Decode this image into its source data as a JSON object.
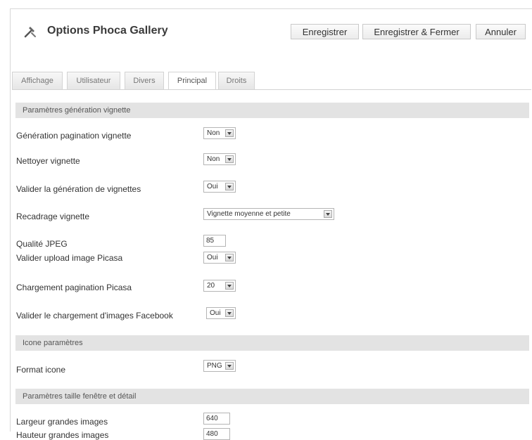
{
  "header": {
    "title": "Options Phoca Gallery",
    "save_label": "Enregistrer",
    "save_close_label": "Enregistrer & Fermer",
    "cancel_label": "Annuler"
  },
  "tabs": [
    {
      "label": "Affichage"
    },
    {
      "label": "Utilisateur"
    },
    {
      "label": "Divers"
    },
    {
      "label": "Principal",
      "active": true
    },
    {
      "label": "Droits"
    }
  ],
  "sections": {
    "thumbnail_generation": "Paramètres génération vignette",
    "icon_params": "Icone paramètres",
    "window_size": "Paramètres taille fenêtre et détail"
  },
  "fields": {
    "thumb_pagination": {
      "label": "Génération pagination vignette",
      "value": "Non"
    },
    "clean_thumbs": {
      "label": "Nettoyer vignette",
      "value": "Non"
    },
    "enable_thumb_gen": {
      "label": "Valider la génération de vignettes",
      "value": "Oui"
    },
    "thumb_crop": {
      "label": "Recadrage vignette",
      "value": "Vignette moyenne et petite"
    },
    "jpeg_quality": {
      "label": "Qualité JPEG",
      "value": "85"
    },
    "picasa_upload": {
      "label": "Valider upload image Picasa",
      "value": "Oui"
    },
    "picasa_pagination": {
      "label": "Chargement pagination Picasa",
      "value": "20"
    },
    "facebook_upload": {
      "label": "Valider le chargement d'images Facebook",
      "value": "Oui"
    },
    "icon_format": {
      "label": "Format icone",
      "value": "PNG"
    },
    "large_width": {
      "label": "Largeur grandes images",
      "value": "640"
    },
    "large_height": {
      "label": "Hauteur grandes images",
      "value": "480"
    }
  },
  "colors": {
    "section_bg": "#e3e3e3",
    "button_border": "#c9c9c9"
  }
}
